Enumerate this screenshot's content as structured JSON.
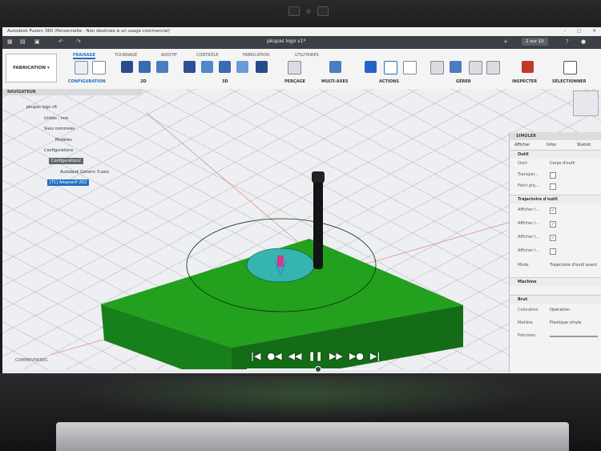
{
  "titlebar": {
    "title": "Autodesk Fusion 360 (Personnelle - Non destinée à un usage commercial)"
  },
  "tabbar": {
    "doc_title": "pkupas logo v1*",
    "time_badge": "2 sur 10"
  },
  "toolbar": {
    "workspace": "FABRICATION",
    "tabs": [
      "FRAISAGE",
      "TOURNAGE",
      "ADDITIF",
      "CONTRÔLE",
      "FABRICATION",
      "UTILITAIRES"
    ],
    "groups": [
      "CONFIGURATION",
      "2D",
      "3D",
      "PERÇAGE",
      "MULTI-AXES",
      "ACTIONS",
      "GÉRER",
      "INSPECTER",
      "SÉLECTIONNER"
    ]
  },
  "navigator": {
    "header": "NAVIGATEUR",
    "items": [
      "pkupas logo v6",
      "Unités : mm",
      "Vues nommées",
      "Modèles",
      "Configurations",
      "Configuration2",
      "Autodesk Generic 3-axis",
      "[T1] Adaptatif 2D2"
    ]
  },
  "simulate": {
    "header": "SIMULER",
    "tabs": [
      "Afficher",
      "Infos",
      "Statisti"
    ],
    "sections": {
      "tool": {
        "title": "Outil",
        "rows": [
          {
            "label": "Outil",
            "value": "Corps d'outil"
          },
          {
            "label": "Transpar...",
            "value": ""
          },
          {
            "label": "Point piq...",
            "value": ""
          }
        ]
      },
      "toolpath": {
        "title": "Trajectoire d'outil",
        "rows": [
          {
            "label": "Afficher l..."
          },
          {
            "label": "Afficher l..."
          },
          {
            "label": "Afficher l..."
          },
          {
            "label": "Afficher l..."
          }
        ],
        "mode_label": "Mode",
        "mode_value": "Trajectoire d'outil avant"
      },
      "machine": {
        "title": "Machine"
      },
      "stock": {
        "title": "Brut",
        "rows": [
          {
            "label": "Coloration",
            "value": "Opération"
          },
          {
            "label": "Matière",
            "value": "Plastique vinyle"
          },
          {
            "label": "Précision",
            "value": ""
          }
        ]
      }
    }
  },
  "footer": {
    "comments": "COMMENTAIRES"
  },
  "playback": {
    "progress": 0.55
  },
  "colors": {
    "accent": "#1e6fc2",
    "stock": "#1f9a1c"
  }
}
